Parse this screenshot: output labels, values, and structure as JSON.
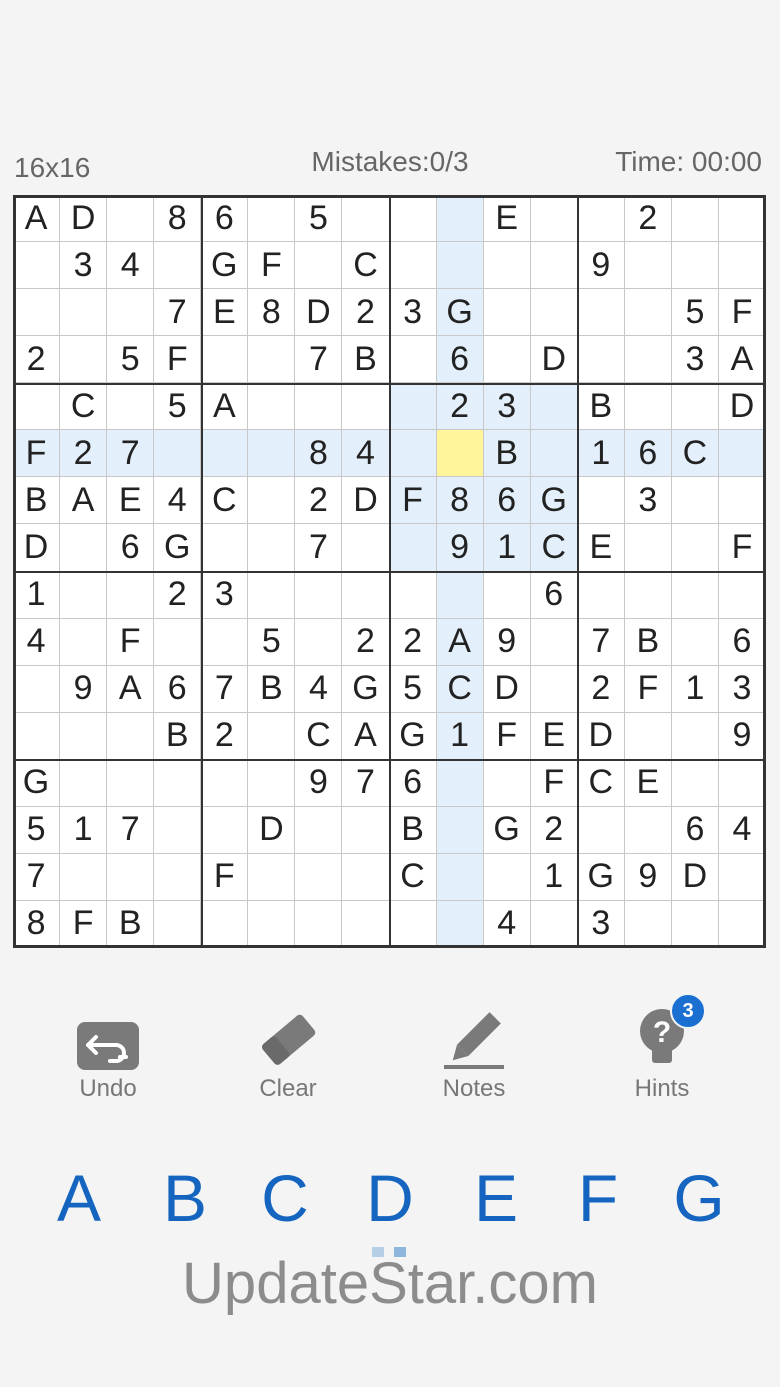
{
  "header": {
    "size_label": "16x16",
    "mistakes_label": "Mistakes:0/3",
    "time_label": "Time: 00:00"
  },
  "board": {
    "selected": [
      5,
      9
    ],
    "rows": [
      [
        "A",
        "D",
        "",
        "8",
        "6",
        "",
        "5",
        "",
        "",
        "",
        "E",
        "",
        "",
        "2",
        "",
        ""
      ],
      [
        "",
        "3",
        "4",
        "",
        "G",
        "F",
        "",
        "C",
        "",
        "",
        "",
        "",
        "9",
        "",
        "",
        ""
      ],
      [
        "",
        "",
        "",
        "7",
        "E",
        "8",
        "D",
        "2",
        "3",
        "G",
        "",
        "",
        "",
        "",
        "5",
        "F"
      ],
      [
        "2",
        "",
        "5",
        "F",
        "",
        "",
        "7",
        "B",
        "",
        "6",
        "",
        "D",
        "",
        "",
        "3",
        "A"
      ],
      [
        "",
        "C",
        "",
        "5",
        "A",
        "",
        "",
        "",
        "",
        "2",
        "3",
        "",
        "B",
        "",
        "",
        "D"
      ],
      [
        "F",
        "2",
        "7",
        "",
        "",
        "",
        "8",
        "4",
        "",
        "",
        "B",
        "",
        "1",
        "6",
        "C",
        ""
      ],
      [
        "B",
        "A",
        "E",
        "4",
        "C",
        "",
        "2",
        "D",
        "F",
        "8",
        "6",
        "G",
        "",
        "3",
        "",
        ""
      ],
      [
        "D",
        "",
        "6",
        "G",
        "",
        "",
        "7",
        "",
        "",
        "9",
        "1",
        "C",
        "E",
        "",
        "",
        "F"
      ],
      [
        "1",
        "",
        "",
        "2",
        "3",
        "",
        "",
        "",
        "",
        "",
        "",
        "6",
        "",
        "",
        "",
        ""
      ],
      [
        "4",
        "",
        "F",
        "",
        "",
        "5",
        "",
        "2",
        "2",
        "A",
        "9",
        "",
        "7",
        "B",
        "",
        "6"
      ],
      [
        "",
        "9",
        "A",
        "6",
        "7",
        "B",
        "4",
        "G",
        "5",
        "C",
        "D",
        "",
        "2",
        "F",
        "1",
        "3"
      ],
      [
        "",
        "",
        "",
        "B",
        "2",
        "",
        "C",
        "A",
        "G",
        "1",
        "F",
        "E",
        "D",
        "",
        "",
        "9"
      ],
      [
        "G",
        "",
        "",
        "",
        "",
        "",
        "9",
        "7",
        "6",
        "",
        "",
        "F",
        "C",
        "E",
        "",
        ""
      ],
      [
        "5",
        "1",
        "7",
        "",
        "",
        "D",
        "",
        "",
        "B",
        "",
        "G",
        "2",
        "",
        "",
        "6",
        "4"
      ],
      [
        "7",
        "",
        "",
        "",
        "F",
        "",
        "",
        "",
        "C",
        "",
        "",
        "1",
        "G",
        "9",
        "D",
        ""
      ],
      [
        "8",
        "F",
        "B",
        "",
        "",
        "",
        "",
        "",
        "",
        "",
        "4",
        "",
        "3",
        "",
        "",
        ""
      ]
    ]
  },
  "tools": {
    "undo": "Undo",
    "clear": "Clear",
    "notes": "Notes",
    "hints": "Hints",
    "hint_count": "3"
  },
  "letters": [
    "A",
    "B",
    "C",
    "D",
    "E",
    "F",
    "G"
  ],
  "watermark": "UpdateStar.com",
  "colors": {
    "accent": "#1565c0",
    "highlight": "#e3f0fb",
    "selected": "#fff59a",
    "badge": "#1a6fd1"
  }
}
